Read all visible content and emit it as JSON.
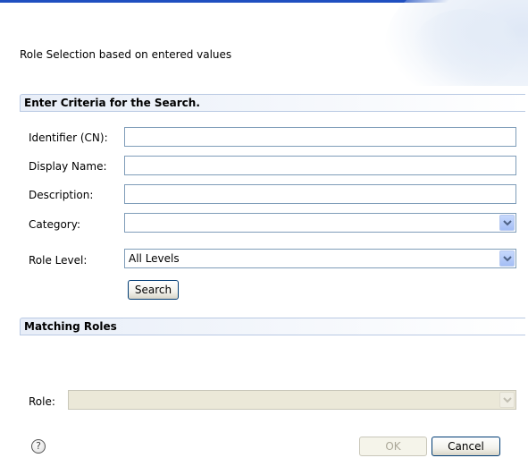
{
  "dialog": {
    "description": "Role Selection based on entered values"
  },
  "criteria": {
    "title": "Enter Criteria for the Search.",
    "identifier_label": "Identifier (CN):",
    "identifier_value": "",
    "display_name_label": "Display Name:",
    "display_name_value": "",
    "description_label": "Description:",
    "description_value": "",
    "category_label": "Category:",
    "category_value": "",
    "role_level_label": "Role Level:",
    "role_level_value": "All Levels",
    "search_button": "Search"
  },
  "matching": {
    "title": "Matching Roles",
    "role_label": "Role:",
    "role_value": ""
  },
  "footer": {
    "help_glyph": "?",
    "ok_button": "OK",
    "cancel_button": "Cancel"
  },
  "colors": {
    "accent_bar": "#1f4fc0",
    "section_border": "#b9c9e3",
    "input_border": "#7f9db9",
    "button_border": "#003c74",
    "disabled_fill": "#ebe8d8"
  },
  "icons": {
    "dropdown": "chevron-down-icon",
    "help": "help-icon"
  }
}
